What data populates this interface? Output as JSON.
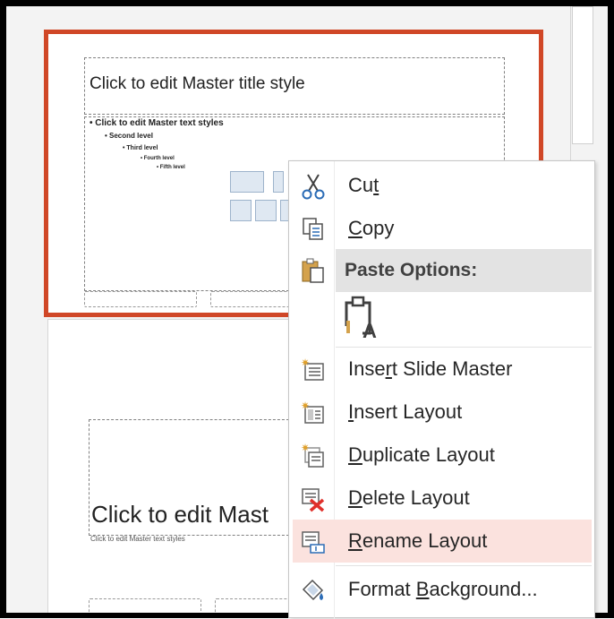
{
  "slides": {
    "master": {
      "title": "Click to edit Master title style",
      "bullets": [
        "• Click to edit Master text styles",
        "• Second level",
        "• Third level",
        "• Fourth level",
        "• Fifth level"
      ]
    },
    "layout": {
      "title": "Click to edit Mast",
      "subtitle": "Click to edit Master text styles"
    }
  },
  "context_menu": {
    "items": [
      {
        "icon": "scissors-icon",
        "pre": "Cu",
        "key": "t",
        "post": ""
      },
      {
        "icon": "copy-icon",
        "pre": "",
        "key": "C",
        "post": "opy"
      },
      {
        "icon": "paste-icon",
        "header": "Paste Options:"
      },
      {
        "icon": "paste-keep-text-icon"
      },
      {
        "icon": "insert-slide-master-icon",
        "pre": "Inse",
        "key": "r",
        "post": "t Slide Master"
      },
      {
        "icon": "insert-layout-icon",
        "pre": "",
        "key": "I",
        "post": "nsert Layout"
      },
      {
        "icon": "duplicate-layout-icon",
        "pre": "",
        "key": "D",
        "post": "uplicate Layout"
      },
      {
        "icon": "delete-layout-icon",
        "pre": "",
        "key": "D",
        "post": "elete Layout"
      },
      {
        "icon": "rename-layout-icon",
        "pre": "",
        "key": "R",
        "post": "ename Layout",
        "highlighted": true
      },
      {
        "icon": "format-background-icon",
        "pre": "Format ",
        "key": "B",
        "post": "ackground..."
      }
    ]
  },
  "colors": {
    "selected_border": "#d04727",
    "highlight": "#fbe2de",
    "delete_x": "#e0302b"
  }
}
